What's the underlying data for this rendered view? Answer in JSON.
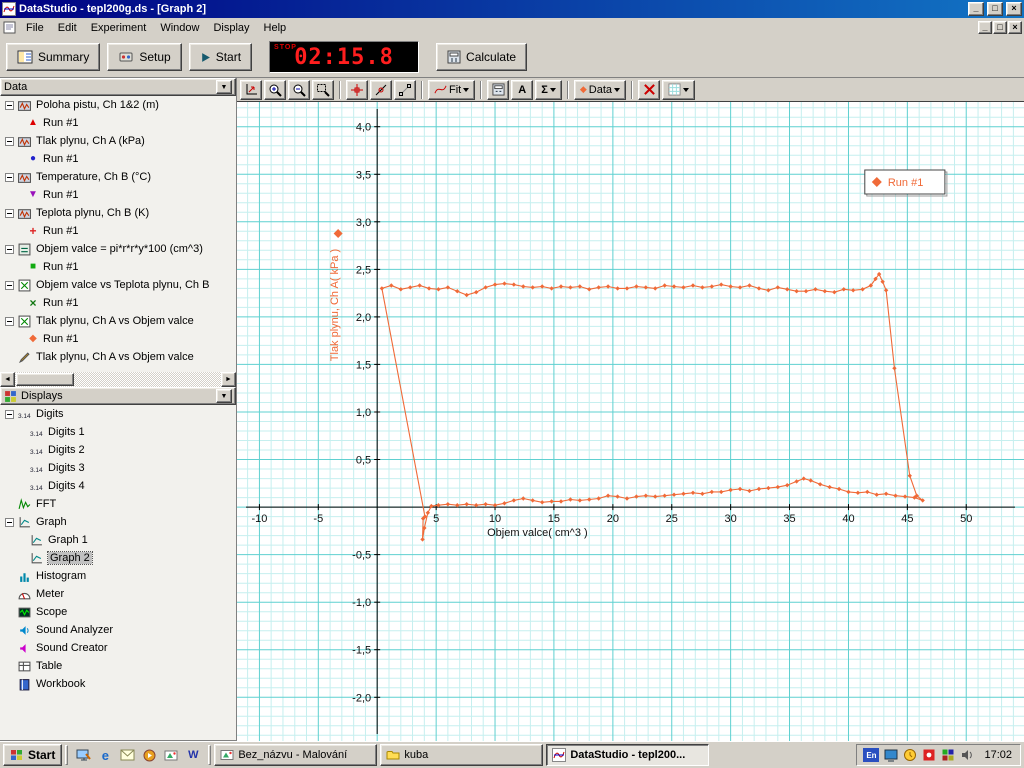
{
  "window": {
    "title": "DataStudio - tepl200g.ds - [Graph 2]",
    "buttons": {
      "minimize": "_",
      "restore": "□",
      "close": "×"
    }
  },
  "menu": {
    "items": [
      "File",
      "Edit",
      "Experiment",
      "Window",
      "Display",
      "Help"
    ]
  },
  "toolbar": {
    "summary": "Summary",
    "setup": "Setup",
    "start": "Start",
    "calculate": "Calculate",
    "timer": {
      "status": "STOP",
      "value": "02:15.8"
    }
  },
  "graph_toolbar": {
    "fit": "Fit",
    "text_tool": "A",
    "statistics": "Σ",
    "data": "Data"
  },
  "data_panel": {
    "title": "Data",
    "items": [
      {
        "label": "Poloha pistu, Ch 1&2 (m)",
        "icon": "sensor",
        "runs": [
          {
            "label": "Run #1",
            "marker": "triangle-up",
            "glyph": "▲",
            "color": "#dd0000"
          }
        ]
      },
      {
        "label": "Tlak plynu, Ch A (kPa)",
        "icon": "sensor",
        "runs": [
          {
            "label": "Run #1",
            "marker": "circle",
            "glyph": "●",
            "color": "#2222cc"
          }
        ]
      },
      {
        "label": "Temperature, Ch B (°C)",
        "icon": "sensor",
        "runs": [
          {
            "label": "Run #1",
            "marker": "triangle-down",
            "glyph": "▼",
            "color": "#9911bb"
          }
        ]
      },
      {
        "label": "Teplota plynu, Ch B (K)",
        "icon": "sensor",
        "runs": [
          {
            "label": "Run #1",
            "marker": "plus",
            "glyph": "+",
            "color": "#dd2222"
          }
        ]
      },
      {
        "label": "Objem valce = pi*r*r*y*100 (cm^3)",
        "icon": "calc",
        "runs": [
          {
            "label": "Run #1",
            "marker": "square",
            "glyph": "■",
            "color": "#11aa11"
          }
        ]
      },
      {
        "label": "Objem valce vs Teplota plynu, Ch B",
        "icon": "xy",
        "runs": [
          {
            "label": "Run #1",
            "marker": "x",
            "glyph": "×",
            "color": "#117711"
          }
        ]
      },
      {
        "label": "Tlak plynu, Ch A vs Objem valce",
        "icon": "xy",
        "runs": [
          {
            "label": "Run #1",
            "marker": "diamond",
            "glyph": "◆",
            "color": "#f06a38"
          }
        ]
      },
      {
        "label": "Tlak plynu, Ch A vs Objem valce",
        "icon": "pen",
        "runs": []
      }
    ]
  },
  "displays_panel": {
    "title": "Displays",
    "items": [
      {
        "label": "Digits",
        "icon": "digits",
        "children": [
          {
            "label": "Digits 1"
          },
          {
            "label": "Digits 2"
          },
          {
            "label": "Digits 3"
          },
          {
            "label": "Digits 4"
          }
        ]
      },
      {
        "label": "FFT",
        "icon": "fft",
        "children": []
      },
      {
        "label": "Graph",
        "icon": "graph",
        "children": [
          {
            "label": "Graph 1"
          },
          {
            "label": "Graph 2",
            "selected": true
          }
        ]
      },
      {
        "label": "Histogram",
        "icon": "histogram",
        "children": []
      },
      {
        "label": "Meter",
        "icon": "meter",
        "children": []
      },
      {
        "label": "Scope",
        "icon": "scope",
        "children": []
      },
      {
        "label": "Sound Analyzer",
        "icon": "sound-analyzer",
        "children": []
      },
      {
        "label": "Sound Creator",
        "icon": "sound-creator",
        "children": []
      },
      {
        "label": "Table",
        "icon": "table",
        "children": []
      },
      {
        "label": "Workbook",
        "icon": "workbook",
        "children": []
      }
    ]
  },
  "chart_data": {
    "type": "scatter",
    "title": "",
    "xlabel": "Objem valce( cm^3 )",
    "ylabel": "Tlak plynu, Ch A( kPa )",
    "xlim": [
      -11.9,
      54.9
    ],
    "ylim": [
      -2.46,
      4.26
    ],
    "xticks": [
      -10,
      -5,
      5,
      10,
      15,
      20,
      25,
      30,
      35,
      40,
      45,
      50
    ],
    "yticks": [
      4.0,
      3.5,
      3.0,
      2.5,
      2.0,
      1.5,
      1.0,
      0.5,
      -0.5,
      -1.0,
      -1.5,
      -2.0
    ],
    "x_minor": 1,
    "x_major": 5,
    "y_minor": 0.1,
    "y_major": 0.5,
    "grid_minor_color": "#c6efef",
    "grid_major_color": "#5fd0d0",
    "legend": {
      "position": "top-right"
    },
    "series": [
      {
        "name": "Run #1",
        "color": "#f06a38",
        "marker": "diamond",
        "points": [
          [
            4.05,
            -0.1
          ],
          [
            0.4,
            2.3
          ],
          [
            1.2,
            2.33
          ],
          [
            2,
            2.29
          ],
          [
            2.8,
            2.31
          ],
          [
            3.6,
            2.33
          ],
          [
            4.4,
            2.3
          ],
          [
            5.2,
            2.29
          ],
          [
            6,
            2.31
          ],
          [
            6.8,
            2.27
          ],
          [
            7.6,
            2.23
          ],
          [
            8.4,
            2.26
          ],
          [
            9.2,
            2.31
          ],
          [
            10,
            2.34
          ],
          [
            10.8,
            2.35
          ],
          [
            11.6,
            2.34
          ],
          [
            12.4,
            2.32
          ],
          [
            13.2,
            2.31
          ],
          [
            14,
            2.32
          ],
          [
            14.8,
            2.3
          ],
          [
            15.6,
            2.32
          ],
          [
            16.4,
            2.31
          ],
          [
            17.2,
            2.32
          ],
          [
            18,
            2.29
          ],
          [
            18.8,
            2.31
          ],
          [
            19.6,
            2.32
          ],
          [
            20.4,
            2.3
          ],
          [
            21.2,
            2.3
          ],
          [
            22,
            2.32
          ],
          [
            22.8,
            2.31
          ],
          [
            23.6,
            2.3
          ],
          [
            24.4,
            2.33
          ],
          [
            25.2,
            2.32
          ],
          [
            26,
            2.31
          ],
          [
            26.8,
            2.33
          ],
          [
            27.6,
            2.31
          ],
          [
            28.4,
            2.32
          ],
          [
            29.2,
            2.34
          ],
          [
            30,
            2.32
          ],
          [
            30.8,
            2.31
          ],
          [
            31.6,
            2.33
          ],
          [
            32.4,
            2.3
          ],
          [
            33.2,
            2.28
          ],
          [
            34,
            2.31
          ],
          [
            34.8,
            2.29
          ],
          [
            35.6,
            2.27
          ],
          [
            36.4,
            2.27
          ],
          [
            37.2,
            2.29
          ],
          [
            38,
            2.27
          ],
          [
            38.8,
            2.26
          ],
          [
            39.6,
            2.29
          ],
          [
            40.4,
            2.28
          ],
          [
            41.2,
            2.29
          ],
          [
            41.9,
            2.33
          ],
          [
            42.3,
            2.4
          ],
          [
            42.6,
            2.45
          ],
          [
            42.9,
            2.37
          ],
          [
            43.2,
            2.28
          ],
          [
            43.9,
            1.46
          ],
          [
            45.2,
            0.33
          ],
          [
            45.8,
            0.12
          ],
          [
            46.3,
            0.07
          ],
          [
            45.6,
            0.1
          ],
          [
            44.8,
            0.11
          ],
          [
            44,
            0.12
          ],
          [
            43.2,
            0.14
          ],
          [
            42.4,
            0.13
          ],
          [
            41.6,
            0.16
          ],
          [
            40.8,
            0.15
          ],
          [
            40,
            0.16
          ],
          [
            39.2,
            0.19
          ],
          [
            38.4,
            0.21
          ],
          [
            37.6,
            0.24
          ],
          [
            36.8,
            0.28
          ],
          [
            36.2,
            0.3
          ],
          [
            35.6,
            0.27
          ],
          [
            34.8,
            0.23
          ],
          [
            34,
            0.21
          ],
          [
            33.2,
            0.2
          ],
          [
            32.4,
            0.19
          ],
          [
            31.6,
            0.17
          ],
          [
            30.8,
            0.19
          ],
          [
            30,
            0.18
          ],
          [
            29.2,
            0.16
          ],
          [
            28.4,
            0.16
          ],
          [
            27.6,
            0.14
          ],
          [
            26.8,
            0.15
          ],
          [
            26,
            0.14
          ],
          [
            25.2,
            0.13
          ],
          [
            24.4,
            0.12
          ],
          [
            23.6,
            0.11
          ],
          [
            22.8,
            0.12
          ],
          [
            22,
            0.11
          ],
          [
            21.2,
            0.09
          ],
          [
            20.4,
            0.11
          ],
          [
            19.6,
            0.12
          ],
          [
            18.8,
            0.09
          ],
          [
            18,
            0.08
          ],
          [
            17.2,
            0.07
          ],
          [
            16.4,
            0.08
          ],
          [
            15.6,
            0.06
          ],
          [
            14.8,
            0.06
          ],
          [
            14,
            0.05
          ],
          [
            13.2,
            0.07
          ],
          [
            12.4,
            0.09
          ],
          [
            11.6,
            0.07
          ],
          [
            10.8,
            0.04
          ],
          [
            10,
            0.02
          ],
          [
            9.2,
            0.03
          ],
          [
            8.4,
            0.02
          ],
          [
            7.6,
            0.03
          ],
          [
            6.8,
            0.02
          ],
          [
            6,
            0.03
          ],
          [
            5.2,
            0.02
          ],
          [
            4.6,
            0.01
          ],
          [
            4.3,
            -0.06
          ],
          [
            4,
            -0.22
          ],
          [
            3.85,
            -0.34
          ],
          [
            3.9,
            -0.12
          ]
        ]
      }
    ]
  },
  "taskbar": {
    "start": "Start",
    "tasks": [
      {
        "label": "Bez_názvu - Malování",
        "icon": "paint",
        "active": false
      },
      {
        "label": "kuba",
        "icon": "folder",
        "active": false
      },
      {
        "label": "DataStudio - tepl200...",
        "icon": "datastudio",
        "active": true
      }
    ],
    "tray": {
      "language": "En",
      "clock": "17:02"
    }
  }
}
